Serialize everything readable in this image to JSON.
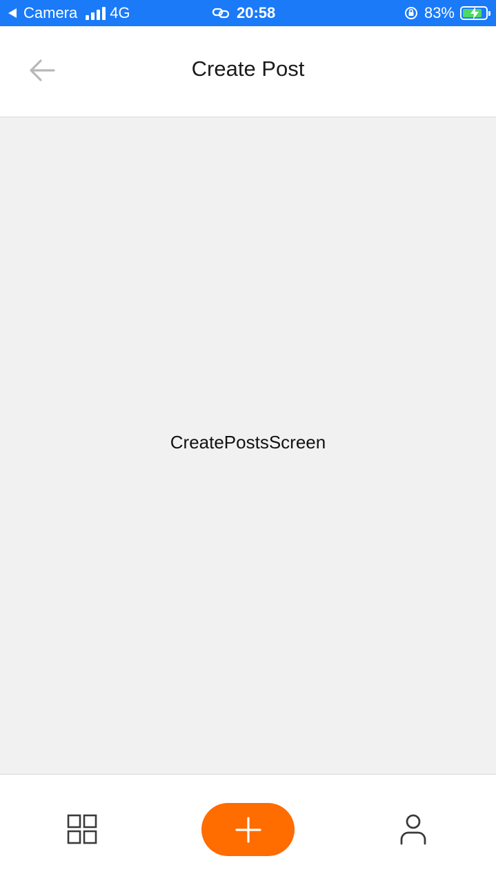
{
  "status_bar": {
    "back_app": "Camera",
    "network": "4G",
    "time": "20:58",
    "battery": "83%",
    "battery_level": 0.83,
    "icons": [
      "back-triangle-icon",
      "signal-icon",
      "link-icon",
      "orientation-lock-icon",
      "battery-charging-icon"
    ]
  },
  "header": {
    "title": "Create Post",
    "back_icon": "arrow-left-icon"
  },
  "main": {
    "label": "CreatePostsScreen"
  },
  "tab_bar": {
    "items": [
      {
        "icon": "grid-icon"
      },
      {
        "icon": "plus-icon",
        "color": "#ff6c00"
      },
      {
        "icon": "user-icon"
      }
    ]
  },
  "colors": {
    "status_bar": "#1a7af8",
    "accent": "#ff6c00",
    "background": "#f1f1f1"
  }
}
